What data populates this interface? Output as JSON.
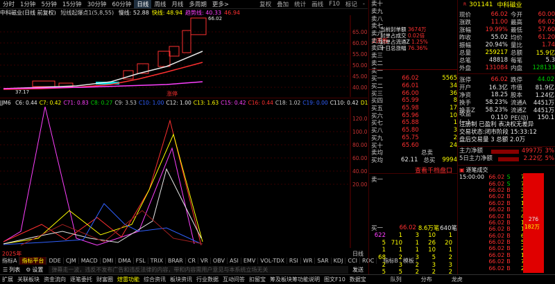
{
  "toolbar": {
    "timeframes": [
      "分时",
      "1分钟",
      "5分钟",
      "15分钟",
      "30分钟",
      "60分钟",
      "日线",
      "周线",
      "月线",
      "多周期",
      "更多>"
    ],
    "selected": "日线",
    "right": [
      "复权",
      "叠加",
      "统计",
      "画线",
      "F10",
      "标记",
      "-"
    ]
  },
  "chart_header": {
    "name": "中科磁业(日线 前复权)",
    "indicator": "短线起爆点1(5,8,55)",
    "items": [
      {
        "label": "慢线: 52.88",
        "color": "#e8e8e8"
      },
      {
        "label": "快线: 48.94",
        "color": "#ffff00"
      },
      {
        "label": "趋势线: 40.33",
        "color": "#ff40ff"
      },
      {
        "label": "46.94",
        "color": "#ff3030"
      }
    ]
  },
  "price_axis": [
    "65.00",
    "60.00",
    "55.00",
    "50.00",
    "45.00",
    "40.00"
  ],
  "annotations": {
    "high": "66.02",
    "low": "37.17",
    "zt_label": "涨停"
  },
  "board_stats": {
    "badge": "2连板",
    "lines": [
      {
        "label": "当前封单额",
        "value": "3674万"
      },
      {
        "label": "封单占成交",
        "value": "0.02倍"
      },
      {
        "label": "封单占流通Z",
        "value": "1.25%"
      },
      {
        "label": "十日总涨幅",
        "value": "76.36%"
      }
    ]
  },
  "ind_header": {
    "name": "JJM6",
    "items": [
      {
        "label": "C6: 0.44",
        "color": "#e8e8e8"
      },
      {
        "label": "C7: 0.42",
        "color": "#ffff00"
      },
      {
        "label": "C71: 0.83",
        "color": "#ff40ff"
      },
      {
        "label": "C8: 0.27",
        "color": "#00d000"
      },
      {
        "label": "C9: 3.53",
        "color": "#c8c8c8"
      },
      {
        "label": "C10: 1.00",
        "color": "#3060ff"
      },
      {
        "label": "C12: 1.00",
        "color": "#e8e8e8"
      },
      {
        "label": "C13: 1.63",
        "color": "#ffff00"
      },
      {
        "label": "C15: 0.42",
        "color": "#ff40ff"
      },
      {
        "label": "C16: 0.44",
        "color": "#ff3030"
      },
      {
        "label": "C18: 1.02",
        "color": "#c8c8c8"
      },
      {
        "label": "C19: 0.00",
        "color": "#3060ff"
      },
      {
        "label": "C110: 0.42",
        "color": "#e8e8e8"
      },
      {
        "label": "D1: 3.74",
        "color": "#ffff00"
      }
    ]
  },
  "ind_axis": [
    "120.00",
    "100.00",
    "80.00",
    "60.00",
    "40.00",
    "20.00"
  ],
  "year_label": "2025年",
  "side_axis_label": "日线",
  "bottom_tabs": [
    "指标A",
    "指标平台",
    "DDE",
    "CJM",
    "MACD",
    "DMI",
    "DMA",
    "FSL",
    "TRIX",
    "BRAR",
    "CR",
    "VR",
    "OBV",
    "ASI",
    "EMV",
    "VOL-TDX",
    "RSI",
    "WR",
    "SAR",
    "KDJ",
    "CCI",
    "ROC"
  ],
  "bottom_tabs_right": [
    "指标B",
    "模板"
  ],
  "system_bar": {
    "list_btn": "列表",
    "settings_btn": "设置",
    "notice": "弹幕走一波，违反不发布广告和违反法律的内容，带和内容需用户意见与本系统立场无关",
    "send_btn": "发送"
  },
  "footer": [
    "扩展",
    "关联板块",
    "资金流向",
    "逐笔委托",
    "财富圈",
    "煊雷功能",
    "综合资讯",
    "板块资讯",
    "行业数据",
    "互动问答",
    "扣留宝",
    "筹及板块筹功能说明",
    "图文F10",
    "数据宝",
    "队列",
    "分布",
    "龙虎"
  ],
  "quote": {
    "code": "301141",
    "name": "中科磁业",
    "rows": [
      {
        "l": "现价",
        "v": "66.02",
        "vc": "red",
        "l2": "今开",
        "v2": "60.00",
        "v2c": "red"
      },
      {
        "l": "涨跌",
        "v": "11.00",
        "vc": "red",
        "l2": "最高",
        "v2": "66.02",
        "v2c": "red"
      },
      {
        "l": "涨幅",
        "v": "19.99%",
        "vc": "red",
        "l2": "最低",
        "v2": "57.60",
        "v2c": "red"
      },
      {
        "l": "昨收",
        "v": "55.02",
        "vc": "wht",
        "l2": "均价",
        "v2": "61.20",
        "v2c": "red"
      },
      {
        "l": "振幅",
        "v": "20.94%",
        "vc": "wht",
        "l2": "量比",
        "v2": "1.74",
        "v2c": "red"
      },
      {
        "l": "总量",
        "v": "259217",
        "vc": "yel",
        "l2": "总额",
        "v2": "15.9亿",
        "v2c": "yel"
      },
      {
        "l": "总笔",
        "v": "48818",
        "vc": "wht",
        "l2": "每笔",
        "v2": "5.3",
        "v2c": "wht"
      },
      {
        "l": "外盘",
        "v": "131084",
        "vc": "red",
        "l2": "内盘",
        "v2": "128133",
        "v2c": "grn"
      }
    ]
  },
  "orderbook": {
    "asks": [
      {
        "label": "卖十",
        "price": "",
        "vol": ""
      },
      {
        "label": "卖九",
        "price": "",
        "vol": ""
      },
      {
        "label": "卖八",
        "price": "",
        "vol": ""
      },
      {
        "label": "卖七",
        "price": "",
        "vol": ""
      },
      {
        "label": "卖六",
        "price": "",
        "vol": ""
      },
      {
        "label": "卖五",
        "price": "",
        "vol": ""
      },
      {
        "label": "卖四",
        "price": "",
        "vol": ""
      },
      {
        "label": "卖三",
        "price": "",
        "vol": ""
      },
      {
        "label": "卖二",
        "price": "",
        "vol": ""
      },
      {
        "label": "卖一",
        "price": "",
        "vol": ""
      }
    ],
    "bids": [
      {
        "label": "买一",
        "price": "66.02",
        "vol": "5565"
      },
      {
        "label": "买二",
        "price": "66.01",
        "vol": "34"
      },
      {
        "label": "买三",
        "price": "66.00",
        "vol": "36"
      },
      {
        "label": "买四",
        "price": "65.99",
        "vol": "8"
      },
      {
        "label": "买五",
        "price": "65.98",
        "vol": "17"
      },
      {
        "label": "买六",
        "price": "65.96",
        "vol": "10"
      },
      {
        "label": "买七",
        "price": "65.88",
        "vol": "1"
      },
      {
        "label": "买八",
        "price": "65.80",
        "vol": "3"
      },
      {
        "label": "买九",
        "price": "65.75",
        "vol": "2"
      },
      {
        "label": "买十",
        "price": "65.60",
        "vol": "24"
      }
    ],
    "ask_avg_label": "卖均",
    "ask_total_label": "总卖",
    "bid_avg_label": "买均",
    "bid_avg": "62.11",
    "bid_total_label": "总买",
    "bid_total": "9994",
    "thousand_link": "查看千档盘口"
  },
  "stats2": {
    "rows": [
      {
        "l": "涨停",
        "v": "66.02",
        "l2": "跌停",
        "v2": "44.02"
      },
      {
        "l": "开户",
        "v": "16.3亿",
        "l2": "市值",
        "v2": "81.9亿"
      },
      {
        "l": "净资",
        "v": "18.25",
        "l2": "股本",
        "v2": "1.24亿"
      },
      {
        "l": "换手",
        "v": "58.23%",
        "l2": "流通A",
        "v2": "4451万"
      },
      {
        "l": "换手Z",
        "v": "58.23%",
        "l2": "流通Z",
        "v2": "4451万"
      },
      {
        "l": "收益(一)",
        "v": "0.110",
        "l2": "PE(动)",
        "v2": "150.1"
      }
    ],
    "notice1": "注册制 已盈利 表决权无差异",
    "notice2": "交易状态:闭市阶段 15:33:12",
    "notice3": "盘后交易量 3 总额 2.0万",
    "flow1_label": "主力净额",
    "flow1_val": "4997万",
    "flow1_pct": "3%",
    "flow2_label": "5日主力净额",
    "flow2_val": "2.22亿",
    "flow2_pct": "5%"
  },
  "ticks": {
    "header": "逐笔成交",
    "rows": [
      {
        "t": "15:00:00",
        "p": "66.02",
        "s": "S",
        "v": "7"
      },
      {
        "t": "",
        "p": "66.02",
        "s": "S",
        "v": "7"
      },
      {
        "t": "",
        "p": "66.02",
        "s": "B",
        "v": "3"
      },
      {
        "t": "",
        "p": "66.02",
        "s": "B",
        "v": "2"
      },
      {
        "t": "",
        "p": "66.02",
        "s": "B",
        "v": "1"
      },
      {
        "t": "",
        "p": "66.02",
        "s": "B",
        "v": "3"
      },
      {
        "t": "",
        "p": "66.02",
        "s": "B",
        "v": "4"
      },
      {
        "t": "",
        "p": "66.02",
        "s": "B",
        "v": "1"
      },
      {
        "t": "",
        "p": "66.02",
        "s": "B",
        "v": "1"
      },
      {
        "t": "",
        "p": "66.02",
        "s": "B",
        "v": "6"
      },
      {
        "t": "",
        "p": "66.02",
        "s": "B",
        "v": "5"
      },
      {
        "t": "",
        "p": "66.02",
        "s": "B",
        "v": "2"
      },
      {
        "t": "",
        "p": "66.02",
        "s": "B",
        "v": "1"
      },
      {
        "t": "",
        "p": "66.02",
        "s": "B",
        "v": "7"
      },
      {
        "t": "",
        "p": "66.02",
        "s": "B",
        "v": "2"
      },
      {
        "t": "",
        "p": "66.02",
        "s": "B",
        "v": "8"
      },
      {
        "t": "",
        "p": "66.02",
        "s": "B",
        "v": "1"
      },
      {
        "t": "",
        "p": "66.02",
        "s": "B",
        "v": "3"
      },
      {
        "t": "",
        "p": "66.02",
        "s": "B",
        "v": "1"
      },
      {
        "t": "",
        "p": "66.02",
        "s": "B",
        "v": "1"
      },
      {
        "t": "",
        "p": "66.02",
        "s": "B",
        "v": "1"
      },
      {
        "t": "",
        "p": "66.02",
        "s": "B",
        "v": "2"
      },
      {
        "t": "",
        "p": "66.02",
        "s": "B",
        "v": "3"
      },
      {
        "t": "",
        "p": "66.02",
        "s": "B",
        "v": "8"
      },
      {
        "t": "",
        "p": "66.02",
        "s": "B",
        "v": "1"
      },
      {
        "t": "",
        "p": "66.02",
        "s": "B",
        "v": "2"
      },
      {
        "t": "",
        "p": "66.02",
        "s": "B",
        "v": "9"
      }
    ],
    "bar_label1": "276",
    "bar_label2": "182万"
  },
  "queue": {
    "ask_label": "卖一",
    "bid_label": "买一",
    "bid_price": "66.02",
    "bid_vol": "8.6万笔",
    "bid_count": "640笔",
    "rows": [
      [
        "622",
        "1",
        "3",
        "10",
        "1"
      ],
      [
        "5",
        "710",
        "1",
        "26",
        "20"
      ],
      [
        "1",
        "1",
        "1",
        "10",
        "1"
      ],
      [
        "68",
        "2",
        "3",
        "5",
        "2"
      ],
      [
        "2",
        "3",
        "2",
        "3",
        "3"
      ],
      [
        "5",
        "5",
        "2",
        "2",
        "2"
      ]
    ]
  },
  "colors": {
    "up": "#ff3030",
    "down": "#00d000",
    "accent": "#ffff00",
    "bg": "#000000"
  }
}
